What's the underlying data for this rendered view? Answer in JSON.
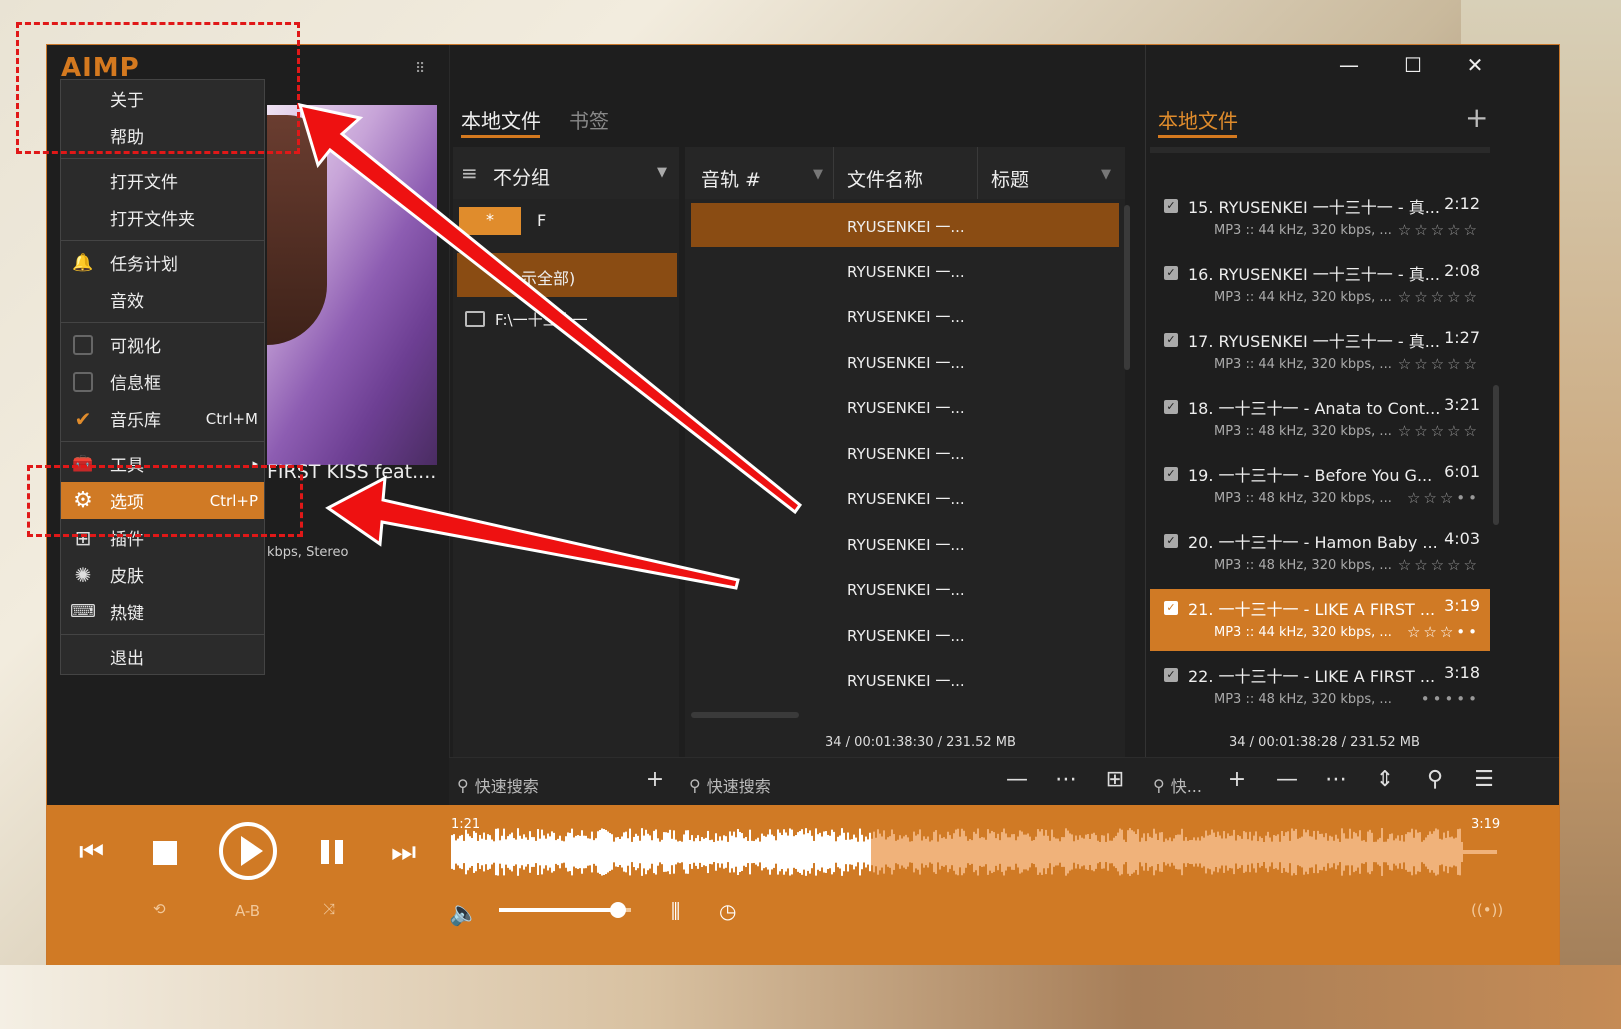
{
  "app": {
    "logo": "AIMP"
  },
  "menu": {
    "items": [
      {
        "label": "关于",
        "name": "menu-item-about"
      },
      {
        "label": "帮助",
        "name": "menu-item-help"
      },
      {
        "label": "打开文件",
        "name": "menu-item-open-file"
      },
      {
        "label": "打开文件夹",
        "name": "menu-item-open-folder"
      },
      {
        "label": "任务计划",
        "name": "menu-item-scheduler"
      },
      {
        "label": "音效",
        "name": "menu-item-sound-effects"
      },
      {
        "label": "可视化",
        "name": "menu-item-visualization"
      },
      {
        "label": "信息框",
        "name": "menu-item-info-box"
      },
      {
        "label": "音乐库",
        "name": "menu-item-music-library",
        "shortcut": "Ctrl+M"
      },
      {
        "label": "工具",
        "name": "menu-item-tools"
      },
      {
        "label": "选项",
        "name": "menu-item-options",
        "shortcut": "Ctrl+P"
      },
      {
        "label": "插件",
        "name": "menu-item-plugins"
      },
      {
        "label": "皮肤",
        "name": "menu-item-skins"
      },
      {
        "label": "热键",
        "name": "menu-item-hotkeys"
      },
      {
        "label": "退出",
        "name": "menu-item-exit"
      }
    ]
  },
  "nowplaying": {
    "title": "FIRST KISS feat....",
    "info": "kbps, Stereo"
  },
  "library": {
    "tabs": [
      "本地文件",
      "书签"
    ],
    "group_label": "不分组",
    "filter_star": "*",
    "filter_letter": "F",
    "all_label": "示全部)",
    "folder": "F:\\一十三十一",
    "columns": [
      "音轨 #",
      "文件名称",
      "标题"
    ],
    "rows": [
      "RYUSENKEI 一...",
      "RYUSENKEI 一...",
      "RYUSENKEI 一...",
      "RYUSENKEI 一...",
      "RYUSENKEI 一...",
      "RYUSENKEI 一...",
      "RYUSENKEI 一...",
      "RYUSENKEI 一...",
      "RYUSENKEI 一...",
      "RYUSENKEI 一...",
      "RYUSENKEI 一..."
    ],
    "status": "34 / 00:01:38:30 / 231.52 MB",
    "search_left": "快速搜索",
    "search_mid": "快速搜索"
  },
  "playlist": {
    "tab": "本地文件",
    "items": [
      {
        "title": "15. RYUSENKEI 一十三十一 - 真...",
        "time": "2:12",
        "info": "MP3 :: 44 kHz, 320 kbps, ...",
        "stars": "☆☆☆☆☆"
      },
      {
        "title": "16. RYUSENKEI 一十三十一 - 真...",
        "time": "2:08",
        "info": "MP3 :: 44 kHz, 320 kbps, ...",
        "stars": "☆☆☆☆☆"
      },
      {
        "title": "17. RYUSENKEI 一十三十一 - 真...",
        "time": "1:27",
        "info": "MP3 :: 44 kHz, 320 kbps, ...",
        "stars": "☆☆☆☆☆"
      },
      {
        "title": "18. 一十三十一 - Anata to Cont...",
        "time": "3:21",
        "info": "MP3 :: 48 kHz, 320 kbps, ...",
        "stars": "☆☆☆☆☆"
      },
      {
        "title": "19. 一十三十一 - Before You G...",
        "time": "6:01",
        "info": "MP3 :: 48 kHz, 320 kbps, ...",
        "stars": "☆☆☆••"
      },
      {
        "title": "20. 一十三十一 - Hamon Baby ...",
        "time": "4:03",
        "info": "MP3 :: 48 kHz, 320 kbps, ...",
        "stars": "☆☆☆☆☆"
      },
      {
        "title": "21. 一十三十一 - LIKE A FIRST ...",
        "time": "3:19",
        "info": "MP3 :: 44 kHz, 320 kbps, ...",
        "stars": "☆☆☆••"
      },
      {
        "title": "22. 一十三十一 - LIKE A FIRST ...",
        "time": "3:18",
        "info": "MP3 :: 48 kHz, 320 kbps, ...",
        "stars": "•••••"
      }
    ],
    "status": "34 / 00:01:38:28 / 231.52 MB",
    "search": "快..."
  },
  "player": {
    "elapsed": "1:21",
    "total": "3:19",
    "ab": "A-B",
    "progress": 0.4,
    "volume": 0.9
  },
  "colors": {
    "accent": "#d07a25",
    "window": "#1e1e1e",
    "annotation": "#e01818"
  }
}
